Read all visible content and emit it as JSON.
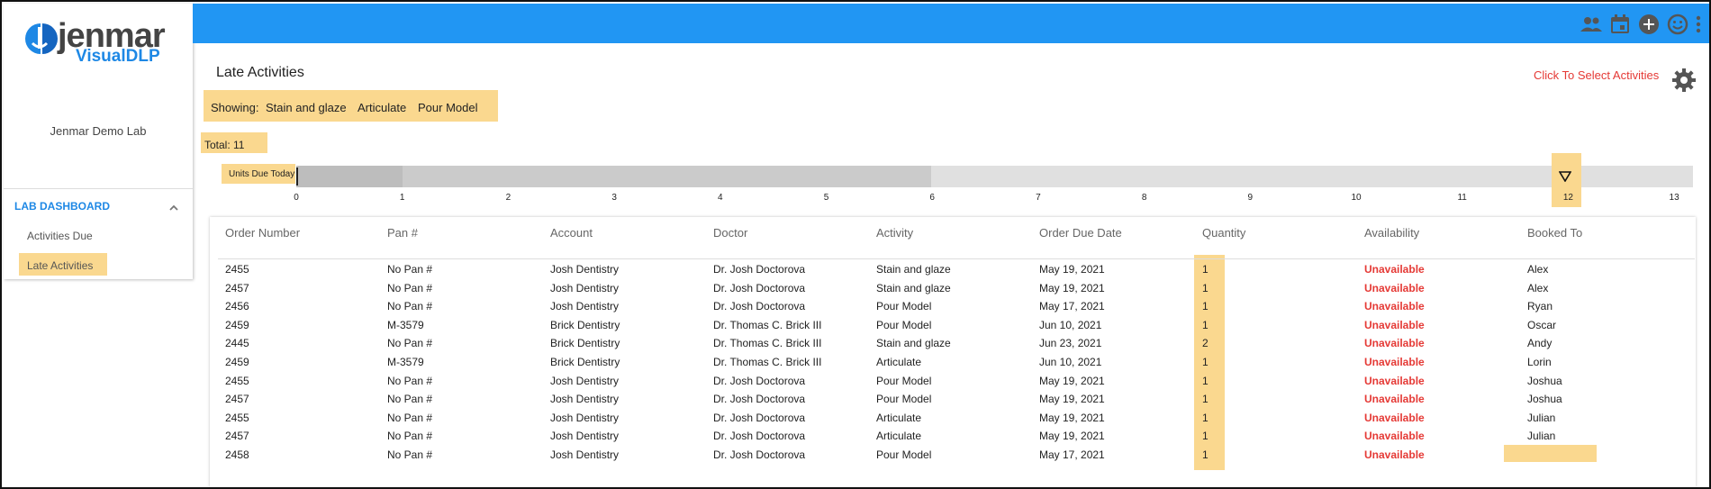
{
  "sidebar": {
    "logo_brand": "jenmar",
    "logo_sub": "VisualDLP",
    "lab_name": "Jenmar Demo Lab",
    "section": "LAB DASHBOARD",
    "items": [
      {
        "label": "Activities Due"
      },
      {
        "label": "Late Activities"
      }
    ]
  },
  "header": {
    "icons": [
      "people-icon",
      "calendar-icon",
      "add-circle-icon",
      "smiley-icon",
      "more-vertical-icon"
    ],
    "bar_color": "#2196f3"
  },
  "main": {
    "title": "Late Activities",
    "select_link": "Click To Select Activities",
    "showing_label": "Showing:",
    "showing_items": [
      "Stain and glaze",
      "Articulate",
      "Pour Model"
    ],
    "total": "Total: 11",
    "progress": {
      "label": "Units Due Today",
      "ticks": [
        "0",
        "1",
        "2",
        "3",
        "4",
        "5",
        "6",
        "7",
        "8",
        "9",
        "10",
        "11",
        "12",
        "13"
      ],
      "marker_value": 12
    },
    "columns": [
      "Order Number",
      "Pan #",
      "Account",
      "Doctor",
      "Activity",
      "Order Due Date",
      "Quantity",
      "Availability",
      "Booked To"
    ],
    "rows": [
      [
        "2455",
        "No Pan #",
        "Josh Dentistry",
        "Dr. Josh Doctorova",
        "Stain and glaze",
        "May 19, 2021",
        "1",
        "Unavailable",
        "Alex"
      ],
      [
        "2457",
        "No Pan #",
        "Josh Dentistry",
        "Dr. Josh Doctorova",
        "Stain and glaze",
        "May 19, 2021",
        "1",
        "Unavailable",
        "Alex"
      ],
      [
        "2456",
        "No Pan #",
        "Josh Dentistry",
        "Dr. Josh Doctorova",
        "Pour Model",
        "May 17, 2021",
        "1",
        "Unavailable",
        "Ryan"
      ],
      [
        "2459",
        "M-3579",
        "Brick Dentistry",
        "Dr. Thomas C. Brick III",
        "Pour Model",
        "Jun 10, 2021",
        "1",
        "Unavailable",
        "Oscar"
      ],
      [
        "2445",
        "No Pan #",
        "Brick Dentistry",
        "Dr. Thomas C. Brick III",
        "Stain and glaze",
        "Jun 23, 2021",
        "2",
        "Unavailable",
        "Andy"
      ],
      [
        "2459",
        "M-3579",
        "Brick Dentistry",
        "Dr. Thomas C. Brick III",
        "Articulate",
        "Jun 10, 2021",
        "1",
        "Unavailable",
        "Lorin"
      ],
      [
        "2455",
        "No Pan #",
        "Josh Dentistry",
        "Dr. Josh Doctorova",
        "Pour Model",
        "May 19, 2021",
        "1",
        "Unavailable",
        "Joshua"
      ],
      [
        "2457",
        "No Pan #",
        "Josh Dentistry",
        "Dr. Josh Doctorova",
        "Pour Model",
        "May 19, 2021",
        "1",
        "Unavailable",
        "Joshua"
      ],
      [
        "2455",
        "No Pan #",
        "Josh Dentistry",
        "Dr. Josh Doctorova",
        "Articulate",
        "May 19, 2021",
        "1",
        "Unavailable",
        "Julian"
      ],
      [
        "2457",
        "No Pan #",
        "Josh Dentistry",
        "Dr. Josh Doctorova",
        "Articulate",
        "May 19, 2021",
        "1",
        "Unavailable",
        "Julian"
      ],
      [
        "2458",
        "No Pan #",
        "Josh Dentistry",
        "Dr. Josh Doctorova",
        "Pour Model",
        "May 17, 2021",
        "1",
        "Unavailable",
        ""
      ]
    ],
    "highlight_color": "#fad88f",
    "unavailable_color": "#e53935"
  }
}
